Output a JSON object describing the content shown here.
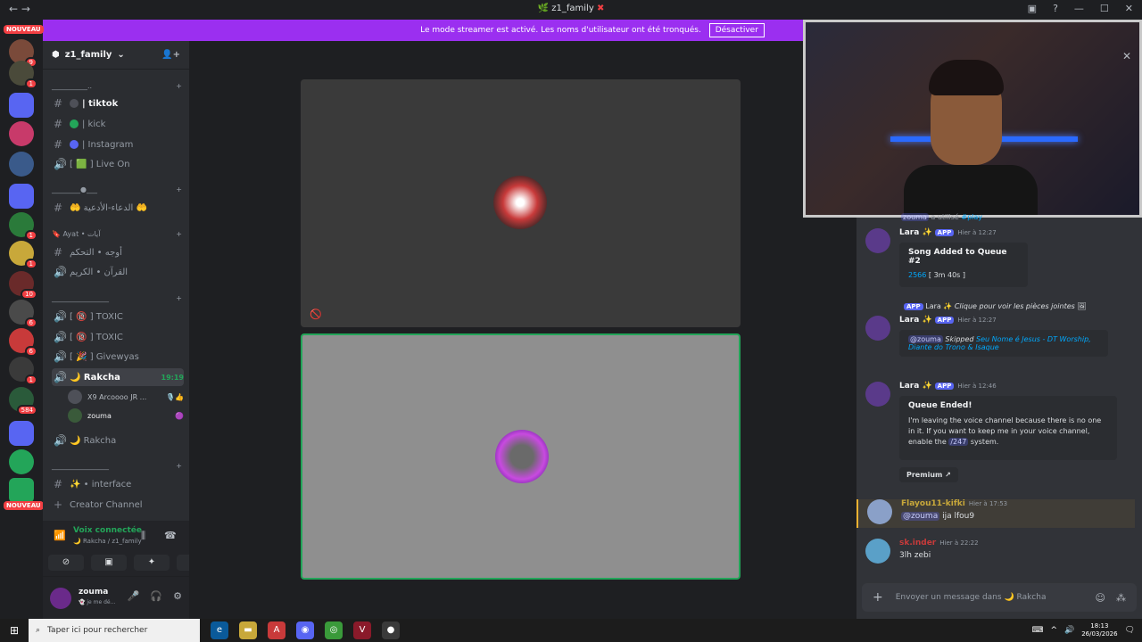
{
  "window": {
    "title": "z1_family",
    "title_emoji": "🌿",
    "title_flag": "✖"
  },
  "banner": {
    "text": "Le mode streamer est activé. Les noms d'utilisateur ont été tronqués.",
    "button": "Désactiver"
  },
  "servers": {
    "nouveau_top": "NOUVEAU",
    "nouveau_bottom": "NOUVEAU",
    "badges": [
      "9",
      "1",
      "1",
      "1",
      "10",
      "6",
      "6",
      "1",
      "584"
    ],
    "colors": [
      "#7a4a3a",
      "#5865f2",
      "#c83a6a",
      "#3a5a8a",
      "#5865f2",
      "#2a7a3a",
      "#c8a83a",
      "#6a2a2a",
      "#4a4a4a",
      "#c83a3a",
      "#3a3a3a",
      "#2a5a3a",
      "#5865f2",
      "#23a559",
      "#23a559"
    ]
  },
  "sidebar": {
    "guild_name": "z1_family",
    "categories": [
      {
        "label": "__________.. ",
        "suffix": "+"
      },
      {
        "label": "________●___",
        "suffix": "+"
      },
      {
        "label": "🔖 Ayat • آيات",
        "suffix": "+"
      },
      {
        "label": "________________",
        "suffix": "+"
      },
      {
        "label": "________________",
        "suffix": "+"
      }
    ],
    "channels": [
      {
        "sym": "#",
        "dot": "#4e5058",
        "label": "| tiktok",
        "bold": true
      },
      {
        "sym": "#",
        "dot": "#23a559",
        "label": "| kick"
      },
      {
        "sym": "#",
        "dot": "#5865f2",
        "label": "| Instagram"
      },
      {
        "sym": "🔊",
        "label": "[ 🟩 ] Live On"
      },
      {
        "sym": "#",
        "label": "🤲 الدعاء-الأدعية 🤲"
      },
      {
        "sym": "#",
        "label": "أوجه • التحكم"
      },
      {
        "sym": "🔊",
        "label": "القرآن • الكريم"
      },
      {
        "sym": "🔊",
        "label": "[ 🔞 ] TOXIC"
      },
      {
        "sym": "🔊",
        "label": "[ 🔞 ] TOXIC"
      },
      {
        "sym": "🔊",
        "label": "[ 🎉 ] Givewyas"
      },
      {
        "sym": "🔊",
        "label": "🌙 Rakcha",
        "active": true,
        "right": "19:19"
      },
      {
        "sym": "🔊",
        "label": "🌙 Rakcha"
      },
      {
        "sym": "#",
        "label": "✨ • interface"
      },
      {
        "sym": "+",
        "label": "Creator Channel"
      }
    ],
    "voice_users": [
      {
        "name": "X9 Arcoooo JR ...",
        "icons": "🎙️👍"
      },
      {
        "name": "zouma",
        "icons": "🟣"
      }
    ],
    "voice_panel": {
      "status": "Voix connectée",
      "sub": "🌙 Rakcha / z1_family"
    },
    "user": {
      "name": "zouma",
      "status": "👻 je me dé..."
    }
  },
  "chat": {
    "top_line": {
      "user": "zouma",
      "action": "a utilisé",
      "command": "play"
    },
    "messages": [
      {
        "author": "Lara ✨",
        "app": "APP",
        "time": "Hier à 12:27",
        "embed_title": "Song Added to Queue #2",
        "embed_line": "2566",
        "embed_dur": "[ 3m 40s ]"
      },
      {
        "reply_line_author": "Lara ✨",
        "reply_text": "Clique pour voir les pièces jointes",
        "author": "Lara ✨",
        "app": "APP",
        "time": "Hier à 12:27",
        "mention": "@zouma",
        "action": "Skipped",
        "song": "Seu Nome é Jesus - DT Worship, Diante do Trono & Isaque"
      },
      {
        "author": "Lara ✨",
        "app": "APP",
        "time": "Hier à 12:46",
        "embed_title": "Queue Ended!",
        "embed_text": "I'm leaving the voice channel because there is no one in it. If you want to keep me in your voice channel, enable the",
        "embed_cmd": "/247",
        "embed_tail": "system.",
        "button": "Premium"
      },
      {
        "author": "Flayou11-kifki",
        "time": "Hier à 17:53",
        "mention": "@zouma",
        "text": "ija lfou9"
      },
      {
        "author": "sk.inder",
        "time": "Hier à 22:22",
        "text": "3lh zebi"
      }
    ],
    "input_placeholder": "Envoyer un message dans 🌙 Rakcha"
  },
  "taskbar": {
    "search": "Taper ici pour rechercher",
    "time": "18:13",
    "date": "26/03/2026"
  },
  "colors": {
    "accent": "#9b2ff0",
    "online": "#23a559",
    "blurple": "#5865f2"
  }
}
